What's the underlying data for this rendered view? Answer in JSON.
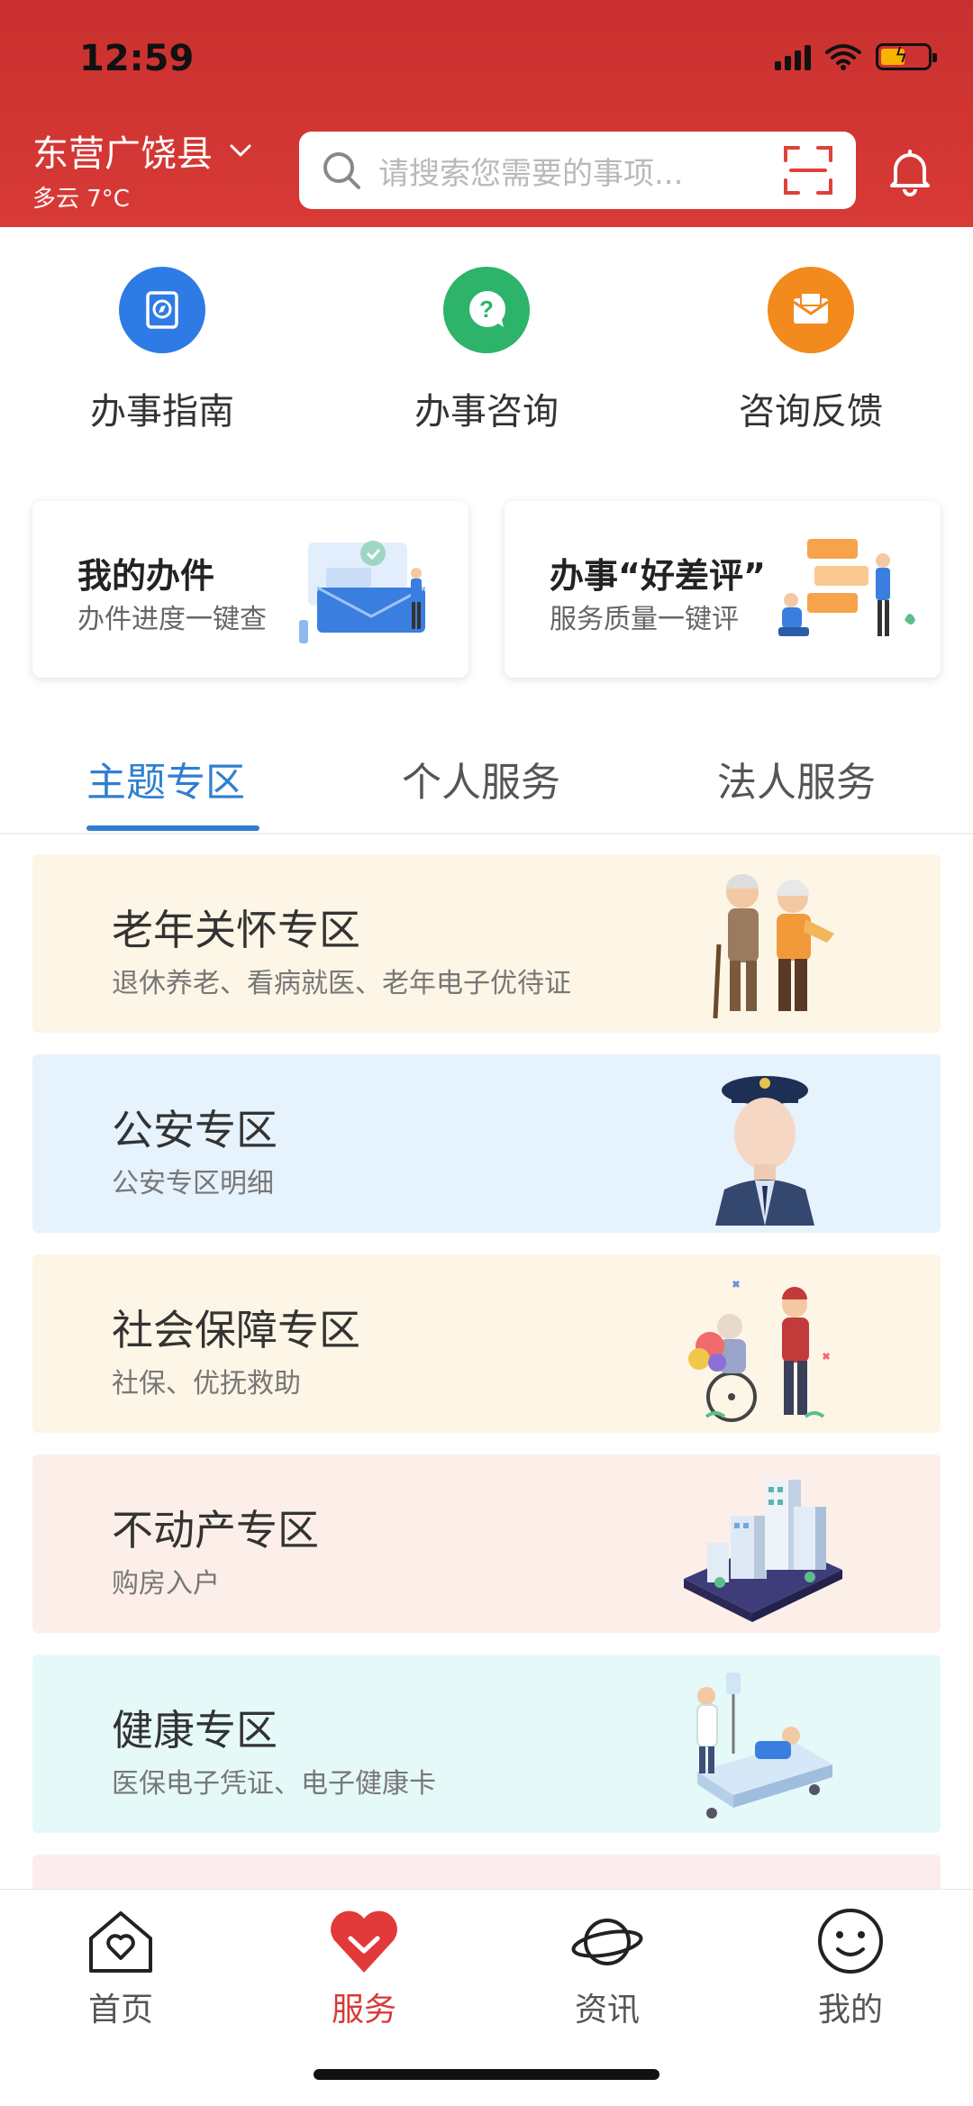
{
  "status_bar": {
    "time": "12:59"
  },
  "header": {
    "location": "东营广饶县",
    "weather": "多云 7°C",
    "search_placeholder": "请搜索您需要的事项..."
  },
  "quick_actions": [
    {
      "label": "办事指南",
      "icon": "compass-book-icon",
      "color": "#2f7be6"
    },
    {
      "label": "办事咨询",
      "icon": "question-bubble-icon",
      "color": "#2db36a"
    },
    {
      "label": "咨询反馈",
      "icon": "envelope-icon",
      "color": "#f28a1e"
    }
  ],
  "cards": [
    {
      "title": "我的办件",
      "subtitle": "办件进度一键查"
    },
    {
      "title": "办事“好差评”",
      "subtitle": "服务质量一键评"
    }
  ],
  "tabs": [
    "主题专区",
    "个人服务",
    "法人服务"
  ],
  "zones": [
    {
      "title": "老年关怀专区",
      "subtitle": "退休养老、看病就医、老年电子优待证",
      "bg": "#fdf5e6",
      "illustration": "elderly-couple"
    },
    {
      "title": "公安专区",
      "subtitle": "公安专区明细",
      "bg": "#e6f2fc",
      "illustration": "police-officer"
    },
    {
      "title": "社会保障专区",
      "subtitle": "社保、优抚救助",
      "bg": "#fdf5e6",
      "illustration": "wheelchair-helper"
    },
    {
      "title": "不动产专区",
      "subtitle": "购房入户",
      "bg": "#fcefe9",
      "illustration": "city-buildings"
    },
    {
      "title": "健康专区",
      "subtitle": "医保电子凭证、电子健康卡",
      "bg": "#e6f9f9",
      "illustration": "hospital-bed"
    }
  ],
  "bottom_nav": [
    {
      "label": "首页",
      "icon": "home-heart-icon",
      "active": false
    },
    {
      "label": "服务",
      "icon": "heart-icon",
      "active": true
    },
    {
      "label": "资讯",
      "icon": "planet-icon",
      "active": false
    },
    {
      "label": "我的",
      "icon": "smiley-icon",
      "active": false
    }
  ],
  "colors": {
    "brand_red": "#d83a36",
    "accent_blue": "#2f7fd0"
  }
}
